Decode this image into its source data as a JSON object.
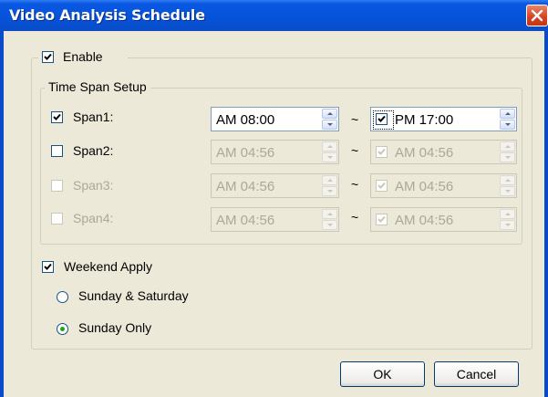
{
  "window": {
    "title": "Video Analysis Schedule"
  },
  "enable": {
    "label": "Enable",
    "checked": true
  },
  "time_span": {
    "legend": "Time Span Setup",
    "spans": [
      {
        "label": "Span1:",
        "checked": true,
        "enabled": true,
        "start": "AM 08:00",
        "end": "PM 17:00",
        "end_checked": true
      },
      {
        "label": "Span2:",
        "checked": false,
        "enabled": true,
        "start": "AM 04:56",
        "end": "AM 04:56",
        "end_checked": true
      },
      {
        "label": "Span3:",
        "checked": false,
        "enabled": false,
        "start": "AM 04:56",
        "end": "AM 04:56",
        "end_checked": true
      },
      {
        "label": "Span4:",
        "checked": false,
        "enabled": false,
        "start": "AM 04:56",
        "end": "AM 04:56",
        "end_checked": true
      }
    ],
    "separator": "~"
  },
  "weekend": {
    "label": "Weekend Apply",
    "checked": true,
    "options": [
      {
        "label": "Sunday & Saturday",
        "selected": false
      },
      {
        "label": "Sunday Only",
        "selected": true
      }
    ]
  },
  "buttons": {
    "ok": "OK",
    "cancel": "Cancel"
  },
  "colors": {
    "title_bar": "#0553d8",
    "close_button": "#d6411f",
    "dialog_bg": "#ece9d8",
    "disabled_text": "#aca899",
    "radio_dot": "#21a121"
  },
  "icons": {
    "close": "close-icon",
    "check": "check-icon",
    "spin_up": "spin-up-icon",
    "spin_down": "spin-down-icon"
  }
}
